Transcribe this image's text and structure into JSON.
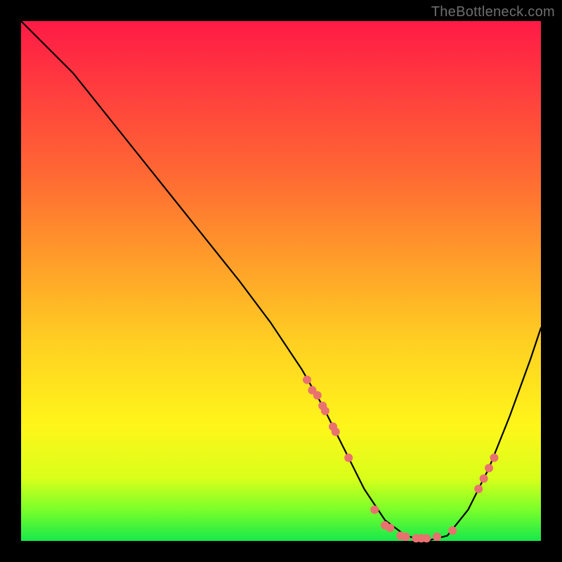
{
  "watermark": "TheBottleneck.com",
  "colors": {
    "background": "#000000",
    "gradient_top": "#ff1a46",
    "gradient_bottom": "#17e84a",
    "curve": "#000000",
    "marker": "#e9716f"
  },
  "chart_data": {
    "type": "line",
    "title": "",
    "xlabel": "",
    "ylabel": "",
    "xlim": [
      0,
      100
    ],
    "ylim": [
      0,
      100
    ],
    "series": [
      {
        "name": "bottleneck-curve",
        "x": [
          0,
          4,
          10,
          18,
          26,
          34,
          42,
          48,
          54,
          58,
          62,
          66,
          70,
          74,
          78,
          82,
          86,
          90,
          94,
          98,
          100
        ],
        "y": [
          100,
          96,
          90,
          80,
          70,
          60,
          50,
          42,
          33,
          26,
          18,
          10,
          4,
          1,
          0,
          1,
          6,
          14,
          24,
          35,
          41
        ]
      }
    ],
    "markers": {
      "name": "highlight-points",
      "x": [
        55,
        56,
        57,
        58,
        58.5,
        60,
        60.5,
        63,
        68,
        70,
        71,
        73,
        74,
        76,
        77,
        78,
        80,
        83,
        88,
        89,
        90,
        91
      ],
      "y": [
        31,
        29,
        28,
        26,
        25,
        22,
        21,
        16,
        6,
        3,
        2.5,
        1,
        0.8,
        0.5,
        0.5,
        0.5,
        0.8,
        2,
        10,
        12,
        14,
        16
      ]
    }
  }
}
